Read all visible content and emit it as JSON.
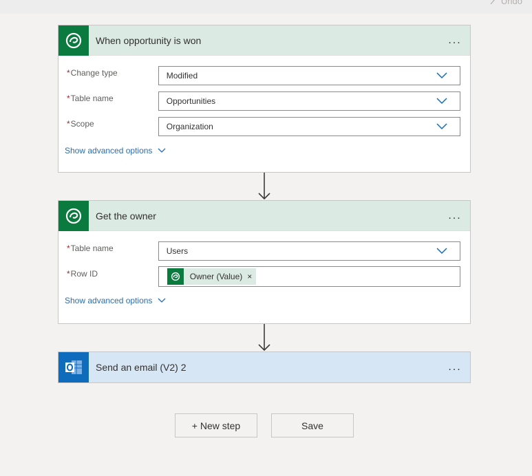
{
  "topbar": {
    "undo_label": "Undo"
  },
  "trigger_card": {
    "title": "When opportunity is won",
    "more": "...",
    "fields": [
      {
        "label": "Change type",
        "value": "Modified"
      },
      {
        "label": "Table name",
        "value": "Opportunities"
      },
      {
        "label": "Scope",
        "value": "Organization"
      }
    ],
    "advanced_label": "Show advanced options"
  },
  "owner_card": {
    "title": "Get the owner",
    "more": "...",
    "table_label": "Table name",
    "table_value": "Users",
    "rowid_label": "Row ID",
    "rowid_token": "Owner (Value)",
    "token_remove": "×",
    "advanced_label": "Show advanced options"
  },
  "email_card": {
    "title": "Send an email (V2) 2",
    "more": "..."
  },
  "required_marker": "*",
  "footer": {
    "new_step_label": "+ New step",
    "save_label": "Save"
  },
  "colors": {
    "dataverse_green": "#0b7a3e",
    "outlook_blue": "#0f6cbd",
    "link_blue": "#2b6cb0",
    "required_red": "#a4262c"
  },
  "icons": {
    "trigger": "dataverse-icon",
    "action": "dataverse-icon",
    "email": "outlook-icon",
    "dropdown": "chevron-down-icon",
    "connector": "arrow-down-icon"
  }
}
